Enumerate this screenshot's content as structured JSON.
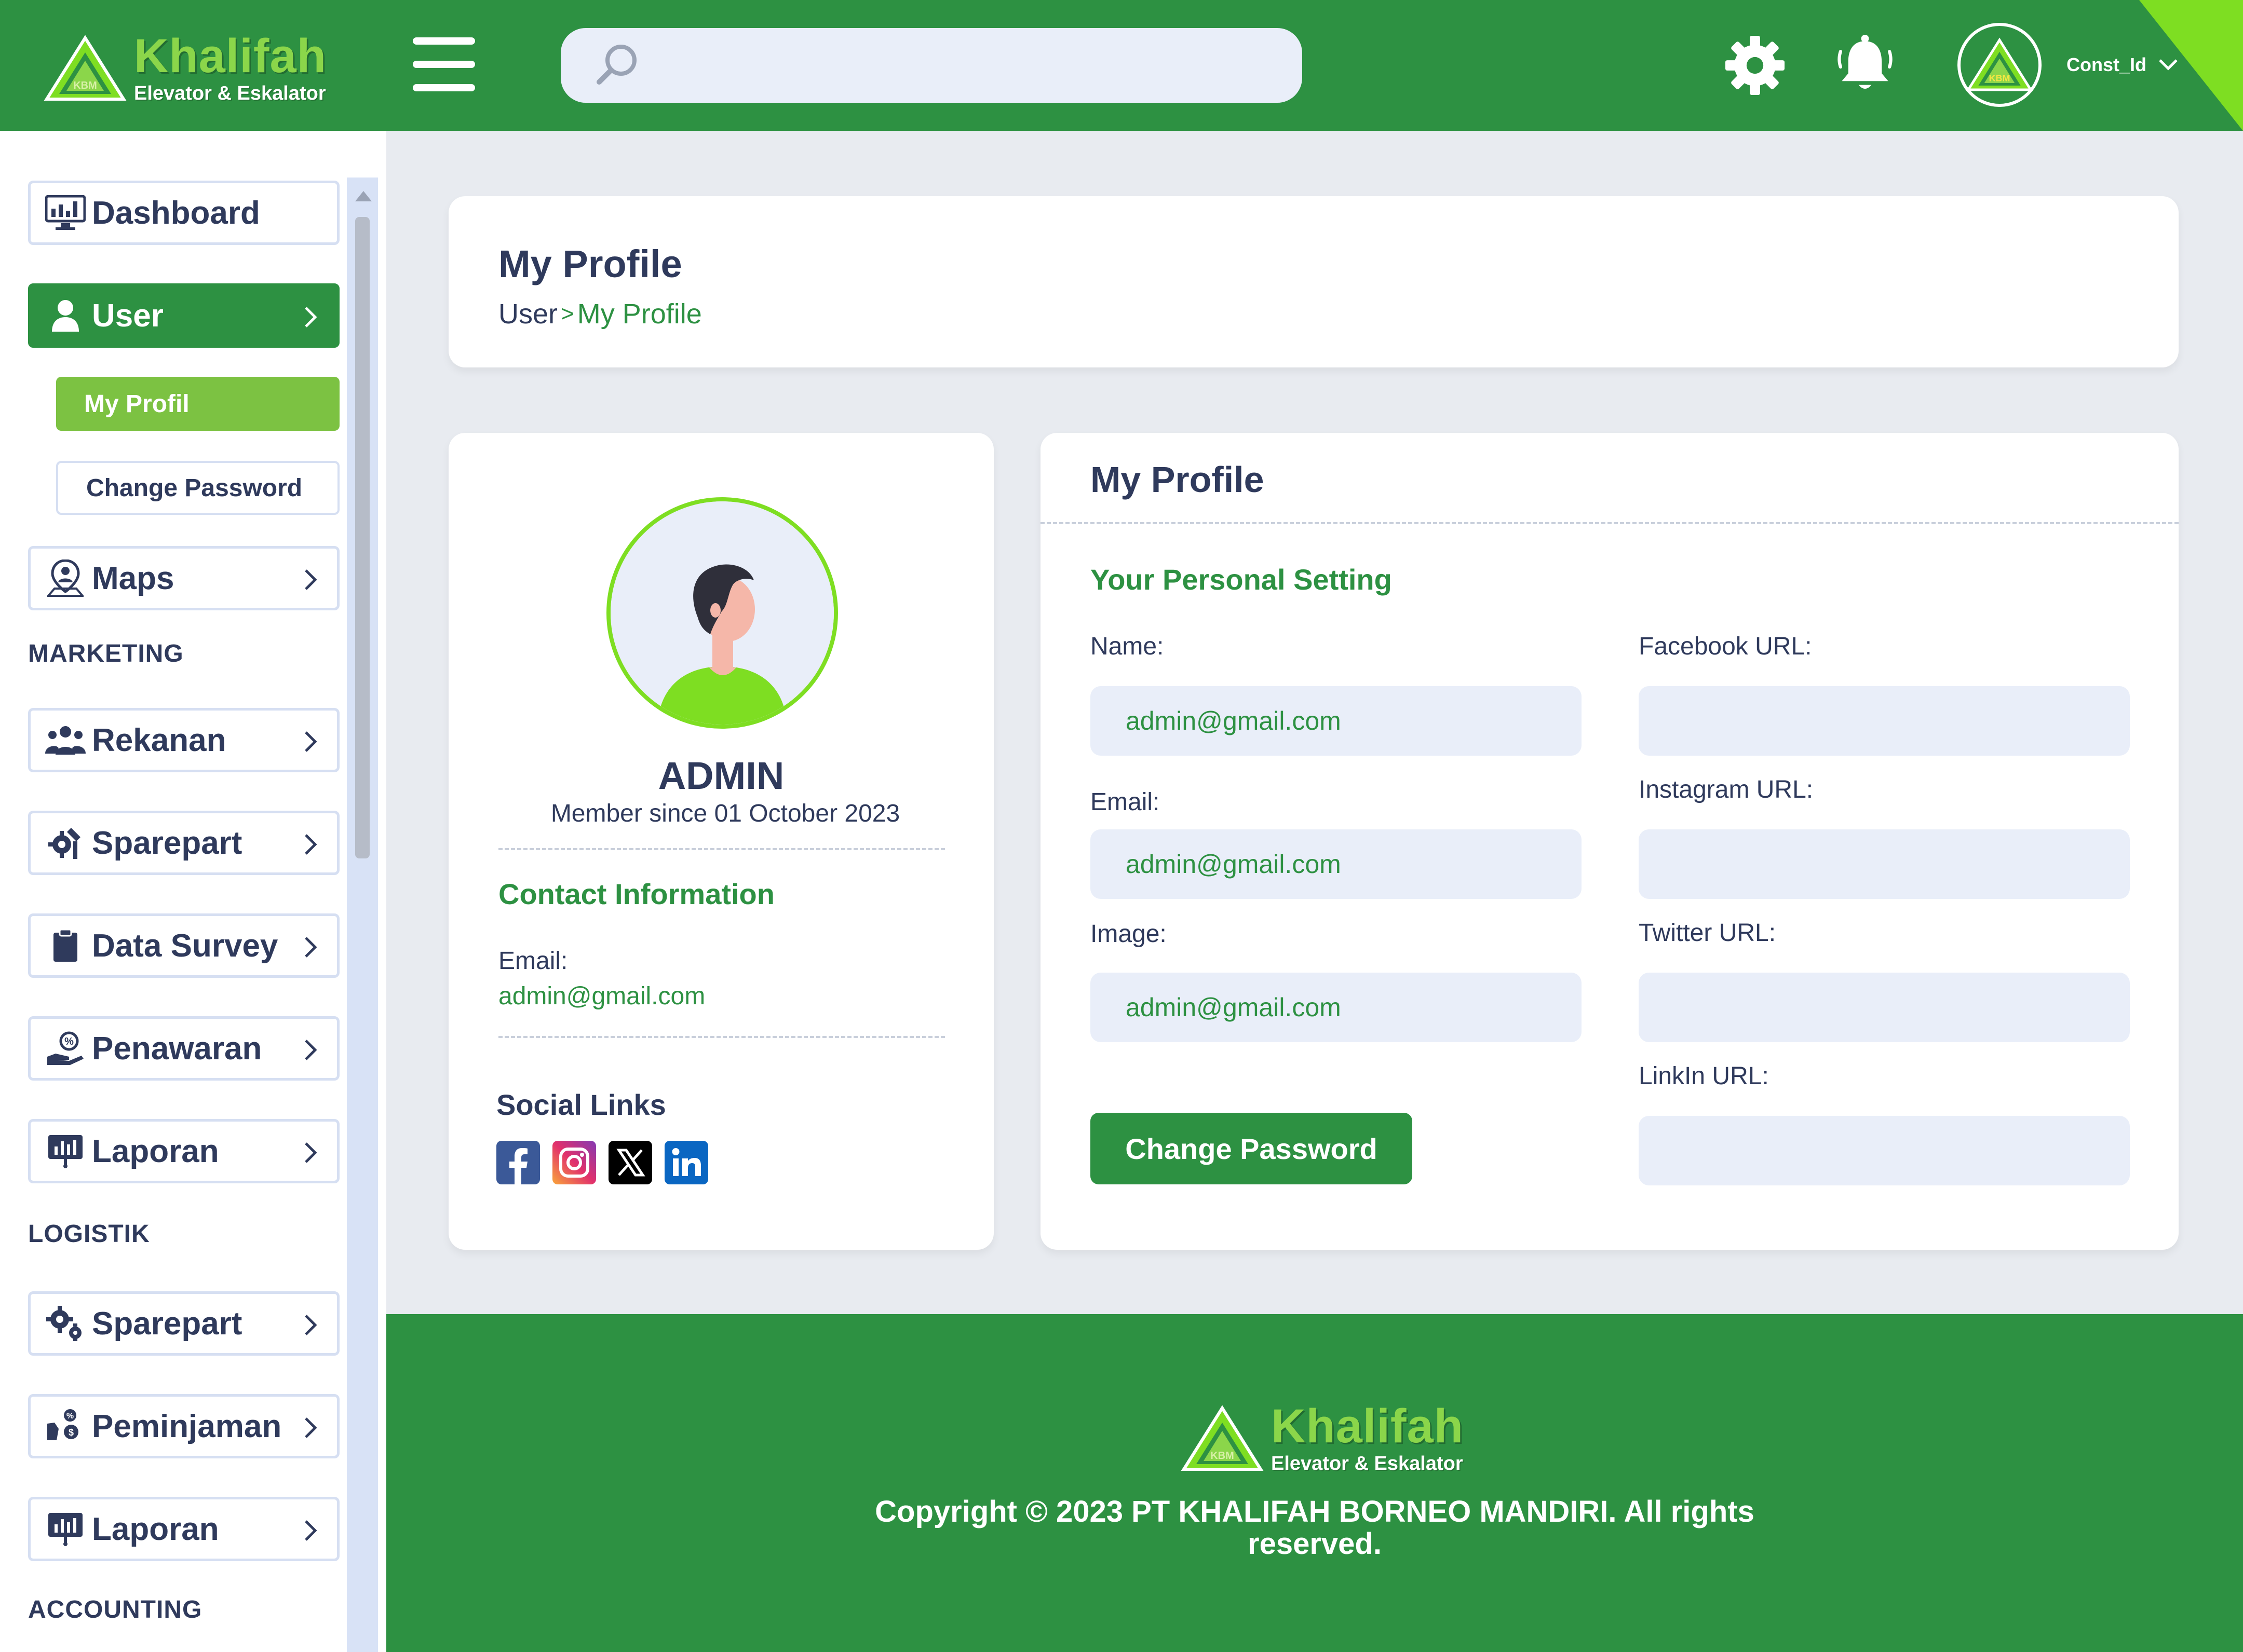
{
  "colors": {
    "primary": "#2d9142",
    "accent": "#7ede22",
    "light_green": "#7cc242",
    "text": "#2f3a5c",
    "field_bg": "#e9eef9"
  },
  "header": {
    "brand_name": "Khalifah",
    "brand_sub": "Elevator & Eskalator",
    "logo_mark": "KBM",
    "search_placeholder": "",
    "user_name": "Const_Id",
    "icons": [
      "menu-icon",
      "search-icon",
      "gear-icon",
      "bell-icon",
      "chevron-down-icon"
    ]
  },
  "sidebar": {
    "dashboard": "Dashboard",
    "user": "User",
    "my_profil": "My Profil",
    "change_password": "Change Password",
    "maps": "Maps",
    "section_marketing": "MARKETING",
    "rekanan": "Rekanan",
    "sparepart_marketing": "Sparepart",
    "data_survey": "Data Survey",
    "penawaran": "Penawaran",
    "laporan_marketing": "Laporan",
    "section_logistik": "LOGISTIK",
    "sparepart_logistik": "Sparepart",
    "peminjaman": "Peminjaman",
    "laporan_logistik": "Laporan",
    "section_accounting": "ACCOUNTING"
  },
  "page": {
    "title": "My Profile",
    "breadcrumb_parent": "User",
    "breadcrumb_separator": ">",
    "breadcrumb_current": "My Profile"
  },
  "profile_card": {
    "name": "ADMIN",
    "member_since": "Member since 01 October 2023",
    "contact_heading": "Contact Information",
    "email_label": "Email:",
    "email_value": "admin@gmail.com",
    "social_heading": "Social Links",
    "socials": [
      "facebook-icon",
      "instagram-icon",
      "x-twitter-icon",
      "linkedin-icon"
    ]
  },
  "settings": {
    "heading": "My Profile",
    "subheading": "Your Personal Setting",
    "name_label": "Name:",
    "name_value": "admin@gmail.com",
    "email_label": "Email:",
    "email_value": "admin@gmail.com",
    "image_label": "Image:",
    "image_value": "admin@gmail.com",
    "facebook_label": "Facebook URL:",
    "facebook_value": "",
    "instagram_label": "Instagram URL:",
    "instagram_value": "",
    "twitter_label": "Twitter URL:",
    "twitter_value": "",
    "linkedin_label": "LinkIn URL:",
    "linkedin_value": "",
    "change_password_button": "Change Password"
  },
  "footer": {
    "brand_name": "Khalifah",
    "brand_sub": "Elevator & Eskalator",
    "copyright_line1": "Copyright © 2023 PT KHALIFAH BORNEO MANDIRI. All rights",
    "copyright_line2": "reserved."
  }
}
